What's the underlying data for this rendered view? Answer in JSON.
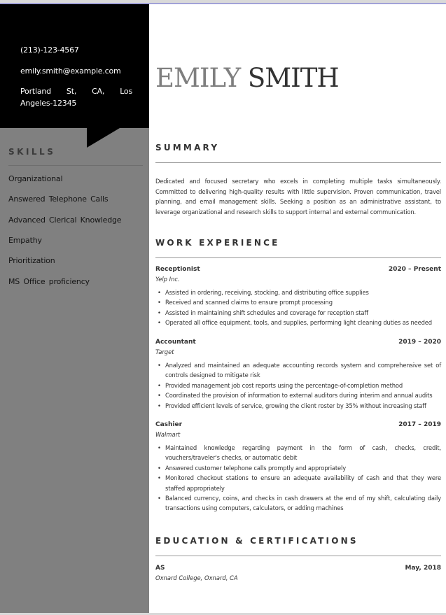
{
  "contact": {
    "phone": "(213)-123-4567",
    "email": "emily.smith@example.com",
    "address": "Portland St, CA, Los Angeles-12345"
  },
  "skills": {
    "title": "SKILLS",
    "items": [
      "Organizational",
      "Answered Telephone Calls",
      "Advanced Clerical Knowledge",
      "Empathy",
      "Prioritization",
      "MS Office proficiency"
    ]
  },
  "name": {
    "first": "EMILY",
    "last": "SMITH"
  },
  "summary": {
    "title": "SUMMARY",
    "text": "Dedicated and focused secretary who excels in completing multiple tasks simultaneously. Committed to delivering high-quality results with little supervision. Proven communication, travel planning, and email management skills. Seeking a position as an administrative assistant, to leverage organizational and research skills to support internal and external communication."
  },
  "experience": {
    "title": "WORK EXPERIENCE",
    "jobs": [
      {
        "role": "Receptionist",
        "dates": "2020 – Present",
        "company": "Yelp Inc.",
        "bullets": [
          "Assisted in ordering, receiving, stocking, and distributing office supplies",
          "Received and scanned claims to ensure prompt processing",
          "Assisted in maintaining shift schedules and coverage for reception staff",
          "Operated all office equipment, tools, and supplies, performing light cleaning duties as needed"
        ]
      },
      {
        "role": "Accountant",
        "dates": "2019 – 2020",
        "company": "Target",
        "bullets": [
          "Analyzed and maintained an adequate accounting records system and comprehensive set of controls designed to mitigate risk",
          "Provided management job cost reports using the percentage-of-completion method",
          "Coordinated the provision of information to external auditors during interim and annual audits",
          "Provided efficient levels of service, growing the client roster by 35% without increasing staff"
        ]
      },
      {
        "role": "Cashier",
        "dates": "2017 – 2019",
        "company": "Walmart",
        "bullets": [
          "Maintained knowledge regarding payment in the form of cash, checks, credit, vouchers/traveler's checks, or automatic debit",
          "Answered customer telephone calls promptly and appropriately",
          "Monitored checkout stations to ensure an adequate availability of cash and that they were staffed appropriately",
          "Balanced currency, coins, and checks in cash drawers at the end of my shift, calculating daily transactions using computers, calculators, or adding machines"
        ]
      }
    ]
  },
  "education": {
    "title": "EDUCATION & CERTIFICATIONS",
    "items": [
      {
        "degree": "AS",
        "date": "May, 2018",
        "school": "Oxnard College, Oxnard, CA"
      }
    ]
  },
  "bullet_glyph": "•"
}
